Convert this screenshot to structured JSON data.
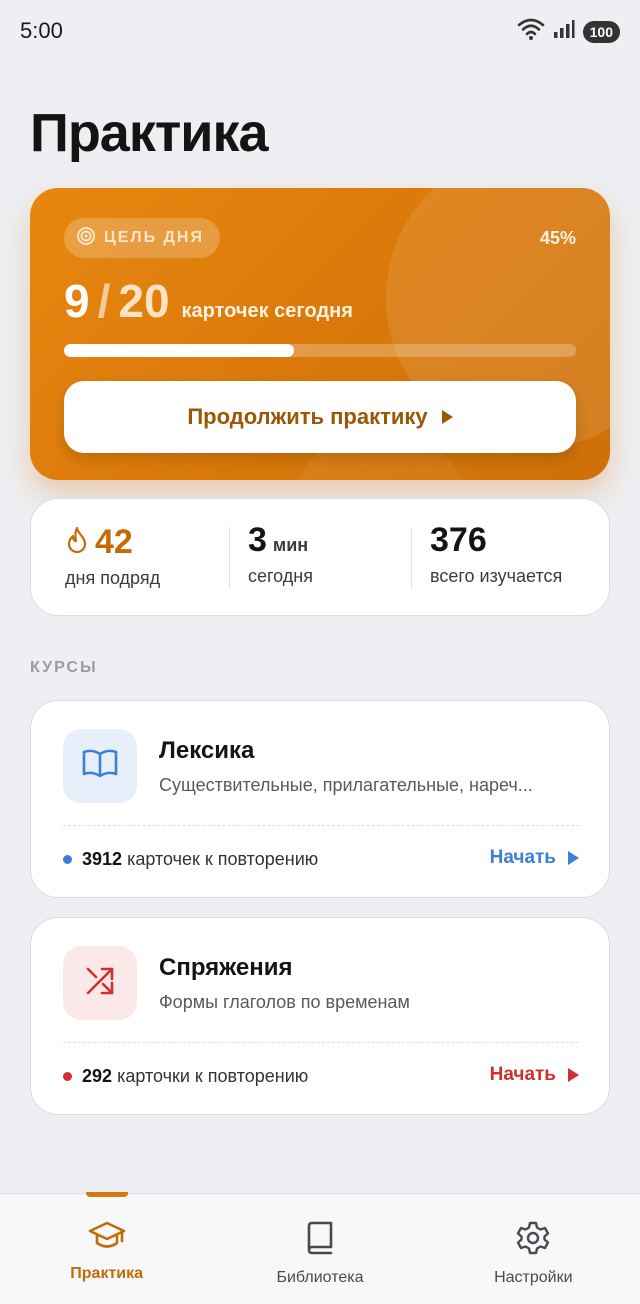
{
  "status_bar": {
    "time": "5:00",
    "battery": "100"
  },
  "page": {
    "title": "Практика"
  },
  "goal": {
    "chip_label": "ЦЕЛЬ ДНЯ",
    "percent_label": "45%",
    "done": "9",
    "slash": "/",
    "total": "20",
    "unit": "карточек сегодня",
    "progress_fraction": 0.45,
    "continue_label": "Продолжить практику"
  },
  "stats": {
    "streak": {
      "value": "42",
      "label": "дня подряд",
      "icon": "flame-icon"
    },
    "time": {
      "value": "3",
      "unit": "мин",
      "label": "сегодня"
    },
    "total": {
      "value": "376",
      "label": "всего изучается"
    }
  },
  "courses_section_label": "КУРСЫ",
  "courses": [
    {
      "title": "Лексика",
      "subtitle": "Существительные, прилагательные, нареч...",
      "due_count": "3912",
      "due_label": "карточек к повторению",
      "start_label": "Начать",
      "icon": "book-open-icon",
      "accent": "#3b7fd6",
      "icon_bg": "#e7effb"
    },
    {
      "title": "Спряжения",
      "subtitle": "Формы глаголов по временам",
      "due_count": "292",
      "due_label": "карточки к повторению",
      "start_label": "Начать",
      "icon": "shuffle-icon",
      "accent": "#cf2f2f",
      "icon_bg": "#fbe9e9"
    }
  ],
  "nav": [
    {
      "label": "Практика",
      "icon": "graduation-cap-icon",
      "active": true
    },
    {
      "label": "Библиотека",
      "icon": "book-icon",
      "active": false
    },
    {
      "label": "Настройки",
      "icon": "gear-icon",
      "active": false
    }
  ],
  "colors": {
    "accent_orange": "#d9780a",
    "background": "#eeeff2"
  }
}
